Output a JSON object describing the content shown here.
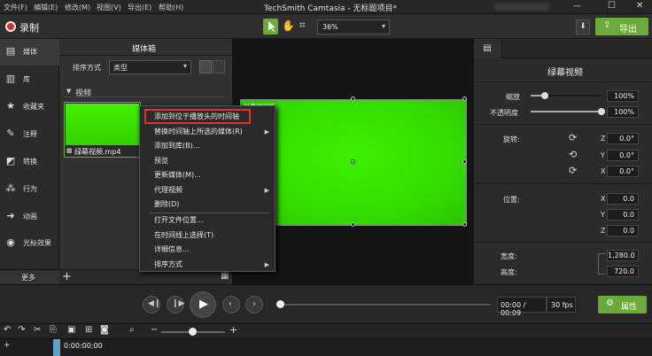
{
  "window": {
    "title": "TechSmith Camtasia - 无标题项目*",
    "user": "",
    "minimize": "—",
    "maximize": "☐",
    "close": "✕"
  },
  "menu": [
    "文件(F)",
    "编辑(E)",
    "修改(M)",
    "视图(V)",
    "导出(E)",
    "帮助(H)"
  ],
  "toolbar": {
    "record": "录制",
    "zoom": "36%",
    "export": "导出"
  },
  "nav": [
    {
      "label": "媒体",
      "icon": "film-icon"
    },
    {
      "label": "库",
      "icon": "library-icon"
    },
    {
      "label": "收藏夹",
      "icon": "star-icon"
    },
    {
      "label": "注释",
      "icon": "annotation-icon"
    },
    {
      "label": "转换",
      "icon": "transition-icon"
    },
    {
      "label": "行为",
      "icon": "behavior-icon"
    },
    {
      "label": "动画",
      "icon": "animation-icon"
    },
    {
      "label": "光标效果",
      "icon": "cursor-effect-icon"
    }
  ],
  "nav_more": "更多",
  "media": {
    "title": "媒体箱",
    "sort_label": "排序方式",
    "sort_value": "类型",
    "section": "视频",
    "clip": "绿幕视频.mp4"
  },
  "context_menu": [
    "添加到位于播放头的时间轴",
    "替换时间轴上所选的媒体(R)",
    "添加到库(B)...",
    "预览",
    "更新媒体(M)...",
    "代理视频",
    "删除(D)",
    "打开文件位置...",
    "在时间线上选择(T)",
    "详细信息...",
    "排序方式"
  ],
  "canvas": {
    "watermark": "科幕视频版"
  },
  "props": {
    "title": "绿幕视频",
    "scale_label": "缩放",
    "scale": "100%",
    "scale_level": 0.2,
    "opacity_label": "不透明度",
    "opacity": "100%",
    "opacity_level": 1.0,
    "rotation_label": "旋转:",
    "rot_z": "0.0°",
    "rot_y": "0.0°",
    "rot_x": "0.0°",
    "position_label": "位置:",
    "pos_x": "0.0",
    "pos_y": "0.0",
    "pos_z": "0.0",
    "width_label": "宽度:",
    "width": "1,280.0",
    "height_label": "高度:",
    "height": "720.0",
    "axis_z": "Z",
    "axis_y": "Y",
    "axis_x": "X",
    "properties_button": "属性"
  },
  "playback": {
    "time": "00:00 / 00:09",
    "fps": "30 fps"
  },
  "timeline": {
    "timecode": "0:00:00;00"
  }
}
